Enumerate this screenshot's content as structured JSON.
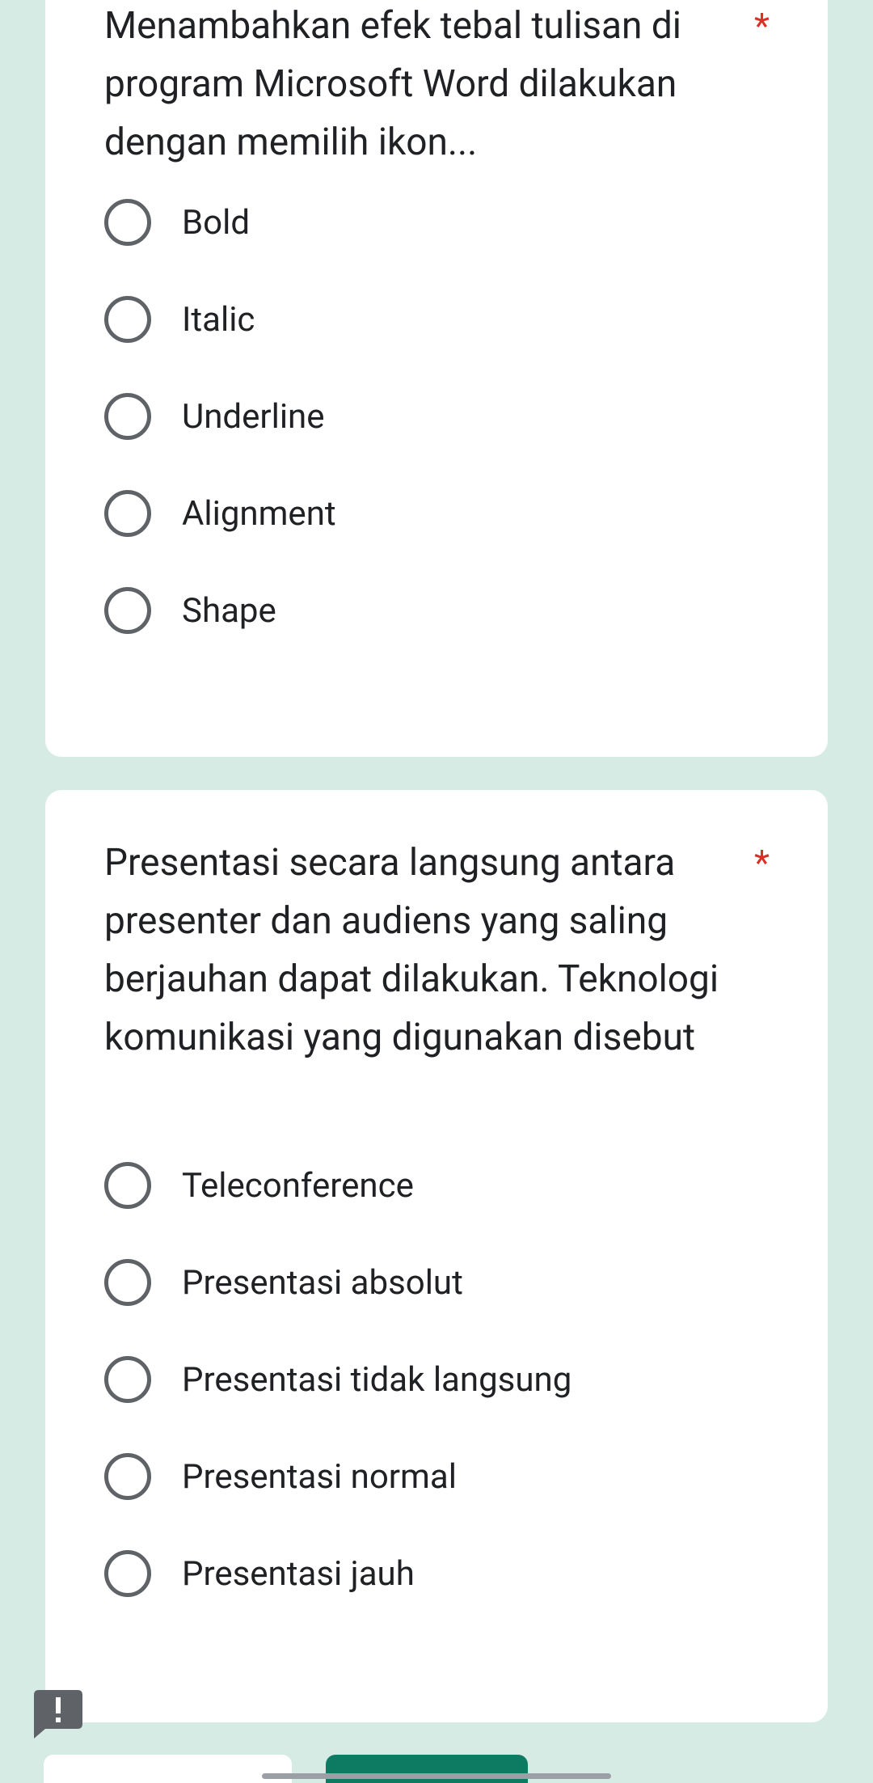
{
  "questions": [
    {
      "text": "Menambahkan efek tebal tulisan di program Microsoft Word dilakukan dengan memilih ikon...",
      "required_mark": "*",
      "options": [
        "Bold",
        "Italic",
        "Underline",
        "Alignment",
        "Shape"
      ]
    },
    {
      "text": "Presentasi secara langsung antara presenter dan audiens yang saling berjauhan dapat dilakukan. Teknologi komunikasi yang digunakan disebut",
      "required_mark": "*",
      "options": [
        "Teleconference",
        "Presentasi absolut",
        "Presentasi tidak langsung",
        "Presentasi normal",
        "Presentasi jauh"
      ]
    }
  ],
  "colors": {
    "background": "#d6ebe4",
    "required": "#d93025",
    "primary_button": "#0d7b62"
  },
  "icons": {
    "report": "report-problem-icon"
  }
}
